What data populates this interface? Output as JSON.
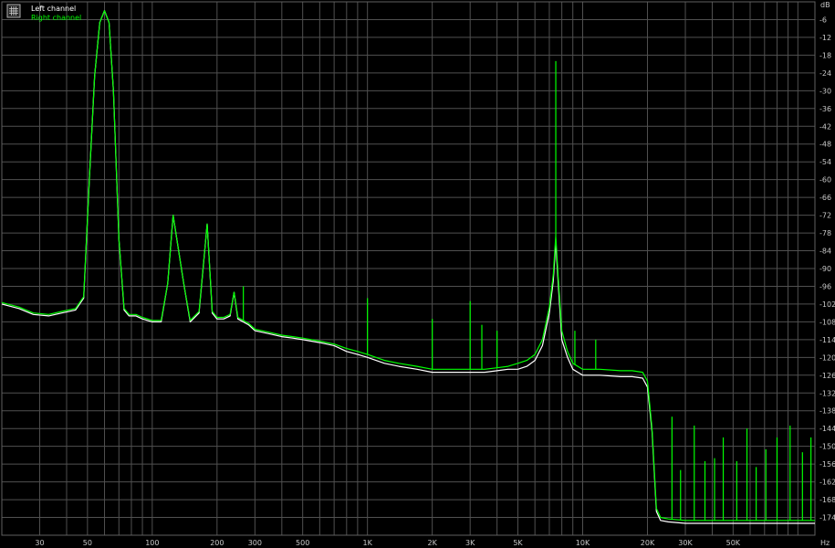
{
  "legend": {
    "icon": "grid-icon",
    "items": [
      {
        "label": "Left channel",
        "color": "#ffffff"
      },
      {
        "label": "Right channel",
        "color": "#00ff00"
      }
    ]
  },
  "chart_data": {
    "type": "line",
    "title": "",
    "xlabel": "",
    "ylabel": "",
    "x_scale": "log",
    "xlim": [
      20,
      120000
    ],
    "ylim": [
      -180,
      0
    ],
    "grid": true,
    "legend_position": "top-left",
    "x_unit": "Hz",
    "y_unit": "dB",
    "x_ticks": [
      {
        "value": 30,
        "label": "30"
      },
      {
        "value": 50,
        "label": "50"
      },
      {
        "value": 100,
        "label": "100"
      },
      {
        "value": 200,
        "label": "200"
      },
      {
        "value": 300,
        "label": "300"
      },
      {
        "value": 500,
        "label": "500"
      },
      {
        "value": 1000,
        "label": "1K"
      },
      {
        "value": 2000,
        "label": "2K"
      },
      {
        "value": 3000,
        "label": "3K"
      },
      {
        "value": 5000,
        "label": "5K"
      },
      {
        "value": 10000,
        "label": "10K"
      },
      {
        "value": 20000,
        "label": "20K"
      },
      {
        "value": 30000,
        "label": "30K"
      },
      {
        "value": 50000,
        "label": "50K"
      }
    ],
    "y_ticks": [
      -6,
      -12,
      -18,
      -24,
      -30,
      -36,
      -42,
      -48,
      -54,
      -60,
      -66,
      -72,
      -78,
      -84,
      -90,
      -96,
      -102,
      -108,
      -114,
      -120,
      -126,
      -132,
      -138,
      -144,
      -150,
      -156,
      -162,
      -168,
      -174
    ],
    "series": [
      {
        "name": "Left channel",
        "color": "#ffffff",
        "x": [
          20,
          24,
          28,
          33,
          38,
          44,
          48,
          51,
          54,
          57,
          60,
          63,
          66,
          70,
          74,
          78,
          84,
          90,
          100,
          110,
          118,
          125,
          140,
          150,
          165,
          180,
          190,
          200,
          215,
          230,
          240,
          250,
          280,
          300,
          350,
          400,
          450,
          500,
          600,
          700,
          800,
          900,
          1000,
          1200,
          1400,
          1700,
          2000,
          2500,
          3000,
          3500,
          4000,
          4500,
          5000,
          5500,
          6000,
          6500,
          7000,
          7300,
          7500,
          7700,
          8000,
          8500,
          9000,
          10000,
          12000,
          15000,
          17000,
          19000,
          20000,
          21000,
          22000,
          23000,
          25000,
          30000,
          40000,
          60000,
          90000,
          120000
        ],
        "y": [
          -102,
          -103.5,
          -105.5,
          -106,
          -105,
          -104,
          -100,
          -60,
          -25,
          -7,
          -3,
          -7,
          -30,
          -80,
          -104,
          -106,
          -106,
          -107,
          -108,
          -108,
          -95,
          -72,
          -95,
          -108,
          -105,
          -75,
          -105,
          -107,
          -107,
          -106,
          -98,
          -107,
          -109,
          -111,
          -112,
          -113,
          -113.5,
          -114,
          -115,
          -116,
          -118,
          -119,
          -120,
          -122,
          -123,
          -124,
          -125,
          -125,
          -125,
          -125,
          -124.5,
          -124,
          -124,
          -123,
          -121,
          -116,
          -105,
          -94,
          -81,
          -95,
          -114,
          -120,
          -124,
          -126,
          -126,
          -126.5,
          -126.5,
          -127,
          -130,
          -145,
          -172,
          -175,
          -175.5,
          -176,
          -176,
          -176,
          -176,
          -176
        ]
      },
      {
        "name": "Right channel",
        "color": "#00ff00",
        "x": [
          20,
          24,
          28,
          33,
          38,
          44,
          48,
          51,
          54,
          57,
          60,
          63,
          66,
          70,
          74,
          78,
          84,
          90,
          100,
          110,
          118,
          125,
          140,
          150,
          165,
          180,
          190,
          200,
          215,
          230,
          240,
          250,
          280,
          300,
          350,
          400,
          450,
          500,
          600,
          700,
          800,
          900,
          1000,
          1200,
          1400,
          1700,
          2000,
          2500,
          3000,
          3500,
          4000,
          4500,
          5000,
          5500,
          6000,
          6500,
          7000,
          7300,
          7500,
          7700,
          8000,
          8500,
          9000,
          10000,
          12000,
          15000,
          17000,
          19000,
          20000,
          21000,
          22000,
          23000,
          25000,
          30000,
          40000,
          60000,
          90000,
          120000
        ],
        "y": [
          -101.5,
          -103,
          -105,
          -105.5,
          -104.5,
          -103.5,
          -99.5,
          -60,
          -25,
          -7,
          -3,
          -7,
          -30,
          -80,
          -103.5,
          -105.5,
          -105.5,
          -106.5,
          -107.5,
          -107.5,
          -95,
          -72,
          -95,
          -107.5,
          -104.5,
          -75,
          -104.5,
          -106.5,
          -106.5,
          -105.5,
          -98,
          -106.5,
          -108.5,
          -110.5,
          -111.5,
          -112.5,
          -113,
          -113.5,
          -114.5,
          -115.5,
          -117,
          -118,
          -119,
          -121,
          -122,
          -123,
          -124,
          -124,
          -124,
          -124,
          -123.5,
          -123,
          -122,
          -121,
          -119,
          -114,
          -103,
          -92,
          -79,
          -93,
          -111,
          -118,
          -122,
          -124,
          -124,
          -124.5,
          -124.5,
          -125,
          -128,
          -144,
          -171,
          -174,
          -174.5,
          -175,
          -175,
          -175,
          -175,
          -175
        ]
      }
    ],
    "spur_peaks": [
      {
        "series": "Right channel",
        "x": 265,
        "y": -96
      },
      {
        "series": "Right channel",
        "x": 1000,
        "y": -100
      },
      {
        "series": "Right channel",
        "x": 2000,
        "y": -107
      },
      {
        "series": "Right channel",
        "x": 3000,
        "y": -101
      },
      {
        "series": "Right channel",
        "x": 3400,
        "y": -109
      },
      {
        "series": "Right channel",
        "x": 4000,
        "y": -111
      },
      {
        "series": "Right channel",
        "x": 7500,
        "y": -20
      },
      {
        "series": "Right channel",
        "x": 9200,
        "y": -111
      },
      {
        "series": "Right channel",
        "x": 11500,
        "y": -114
      },
      {
        "series": "Right channel",
        "x": 26000,
        "y": -140
      },
      {
        "series": "Right channel",
        "x": 28500,
        "y": -158
      },
      {
        "series": "Right channel",
        "x": 33000,
        "y": -143
      },
      {
        "series": "Right channel",
        "x": 37000,
        "y": -155
      },
      {
        "series": "Right channel",
        "x": 41000,
        "y": -154
      },
      {
        "series": "Right channel",
        "x": 45000,
        "y": -147
      },
      {
        "series": "Right channel",
        "x": 52000,
        "y": -155
      },
      {
        "series": "Right channel",
        "x": 58000,
        "y": -144
      },
      {
        "series": "Right channel",
        "x": 64000,
        "y": -157
      },
      {
        "series": "Right channel",
        "x": 71000,
        "y": -151
      },
      {
        "series": "Right channel",
        "x": 80000,
        "y": -147
      },
      {
        "series": "Right channel",
        "x": 92000,
        "y": -143
      },
      {
        "series": "Right channel",
        "x": 105000,
        "y": -152
      },
      {
        "series": "Right channel",
        "x": 115000,
        "y": -147
      }
    ]
  }
}
